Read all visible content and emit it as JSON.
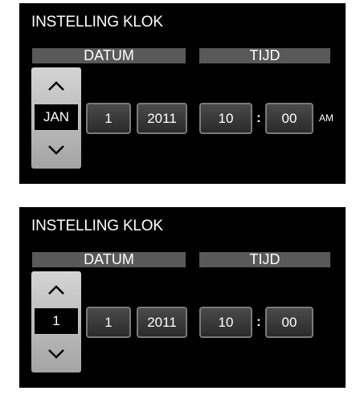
{
  "screens": [
    {
      "title": "INSTELLING KLOK",
      "date_label": "DATUM",
      "time_label": "TIJD",
      "spinner": {
        "up_icon": "▲",
        "value": "JAN",
        "down_icon": "▼"
      },
      "day": "1",
      "year": "2011",
      "hour": "10",
      "separator": ":",
      "minute": "00",
      "ampm": "AM"
    },
    {
      "title": "INSTELLING KLOK",
      "date_label": "DATUM",
      "time_label": "TIJD",
      "spinner": {
        "up_icon": "▲",
        "value": "1",
        "down_icon": "▼"
      },
      "day": "1",
      "year": "2011",
      "hour": "10",
      "separator": ":",
      "minute": "00"
    }
  ],
  "colors": {
    "panel_background": "#000000",
    "section_bar": "#595959",
    "spinner_gradient_top": "#d4d4d4",
    "spinner_gradient_bottom": "#a4a4a4",
    "field_border": "#7a7a7a",
    "text": "#ffffff"
  }
}
